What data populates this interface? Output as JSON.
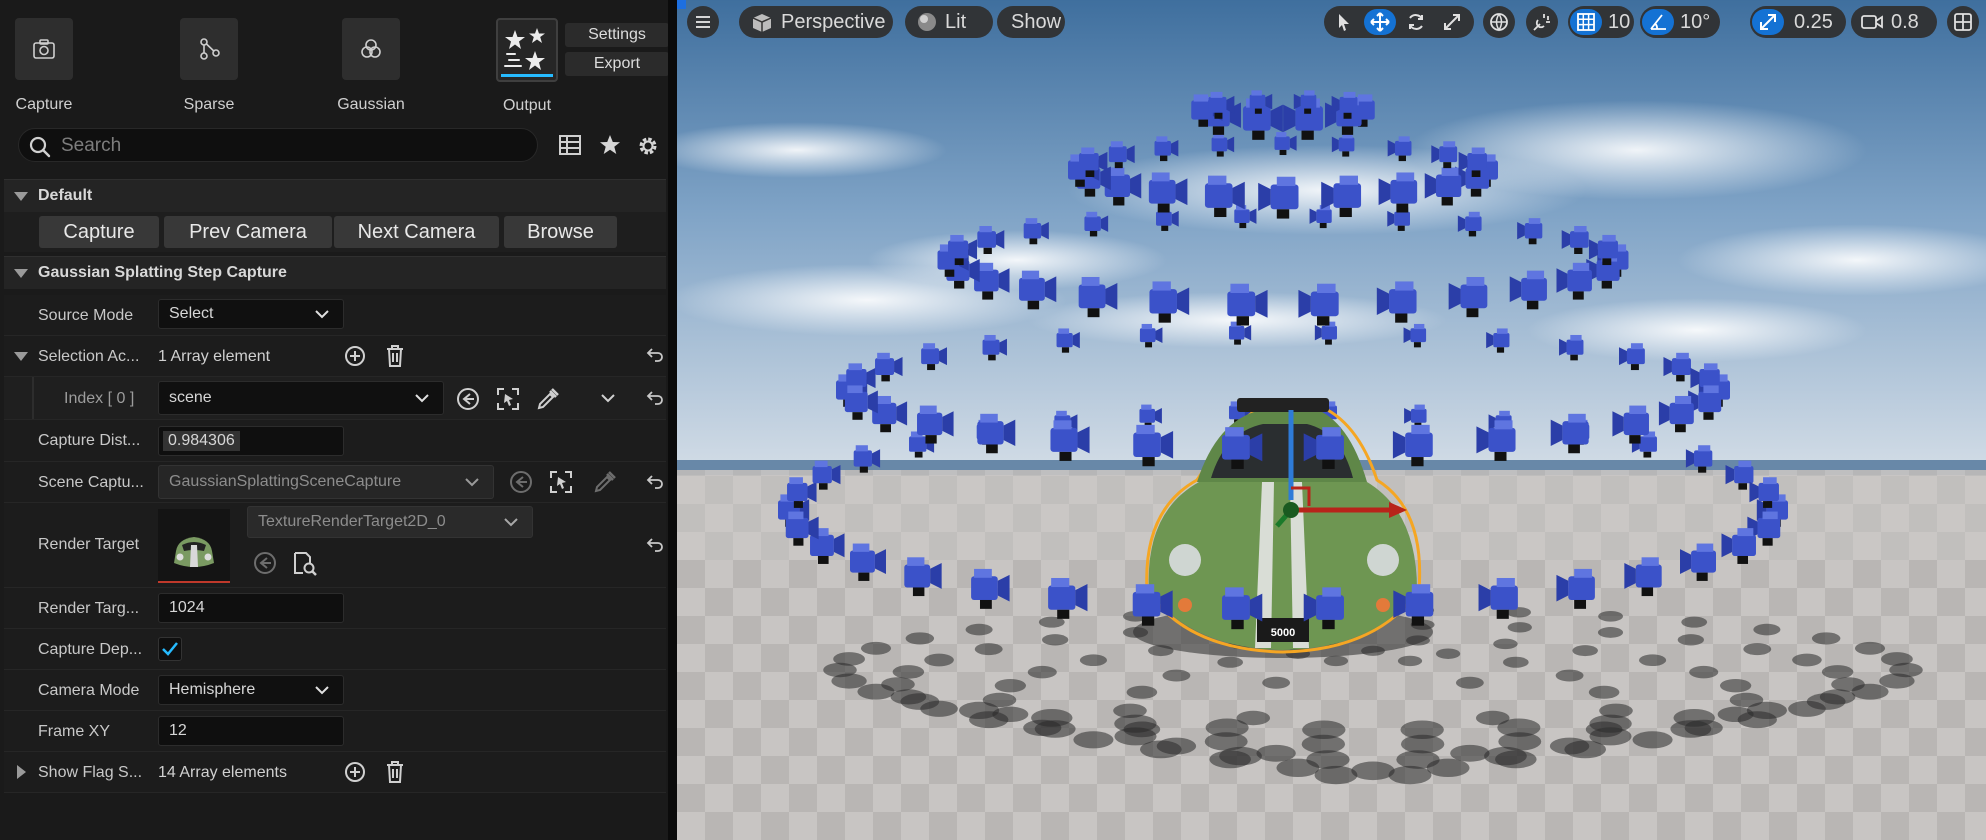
{
  "modes": [
    {
      "label": "Capture",
      "icon": "camera-icon"
    },
    {
      "label": "Sparse",
      "icon": "sparse-nodes-icon"
    },
    {
      "label": "Gaussian",
      "icon": "gaussian-circles-icon"
    },
    {
      "label": "Output",
      "icon": "output-stars-icon"
    }
  ],
  "toolbar": {
    "settings_label": "Settings",
    "export_label": "Export"
  },
  "search": {
    "placeholder": "Search",
    "value": ""
  },
  "details_tools": [
    "table-view-icon",
    "star-icon",
    "gear-icon"
  ],
  "default_category": {
    "title": "Default",
    "buttons": [
      "Capture",
      "Prev Camera",
      "Next Camera",
      "Browse"
    ]
  },
  "capture_category": {
    "title": "Gaussian Splatting Step Capture",
    "source_mode": {
      "label": "Source Mode",
      "value": "Select"
    },
    "selection_actors": {
      "label": "Selection Ac...",
      "value": "1 Array element"
    },
    "index0": {
      "label": "Index [ 0 ]",
      "value": "scene"
    },
    "capture_distance": {
      "label": "Capture Dist...",
      "value": "0.984306"
    },
    "scene_capture": {
      "label": "Scene Captu...",
      "value": "GaussianSplattingSceneCapture"
    },
    "render_target": {
      "label": "Render Target",
      "value": "TextureRenderTarget2D_0"
    },
    "render_target_size": {
      "label": "Render Targ...",
      "value": "1024"
    },
    "capture_depth": {
      "label": "Capture Dep...",
      "checked": true
    },
    "camera_mode": {
      "label": "Camera Mode",
      "value": "Hemisphere"
    },
    "frame_xy": {
      "label": "Frame XY",
      "value": "12"
    },
    "show_flags": {
      "label": "Show Flag S...",
      "value": "14 Array elements"
    }
  },
  "viewport": {
    "perspective_label": "Perspective",
    "lit_label": "Lit",
    "show_label": "Show",
    "grid_snap": "10",
    "rotation_snap": "10°",
    "scale_snap": "0.25",
    "camera_speed": "0.8",
    "license_plate": "5000"
  },
  "colors": {
    "accent": "#26bbff",
    "active_tool": "#1472d4",
    "selection_outline": "#f5a623",
    "camera_blue": "#3b52c9",
    "car_green": "#6e9652"
  }
}
